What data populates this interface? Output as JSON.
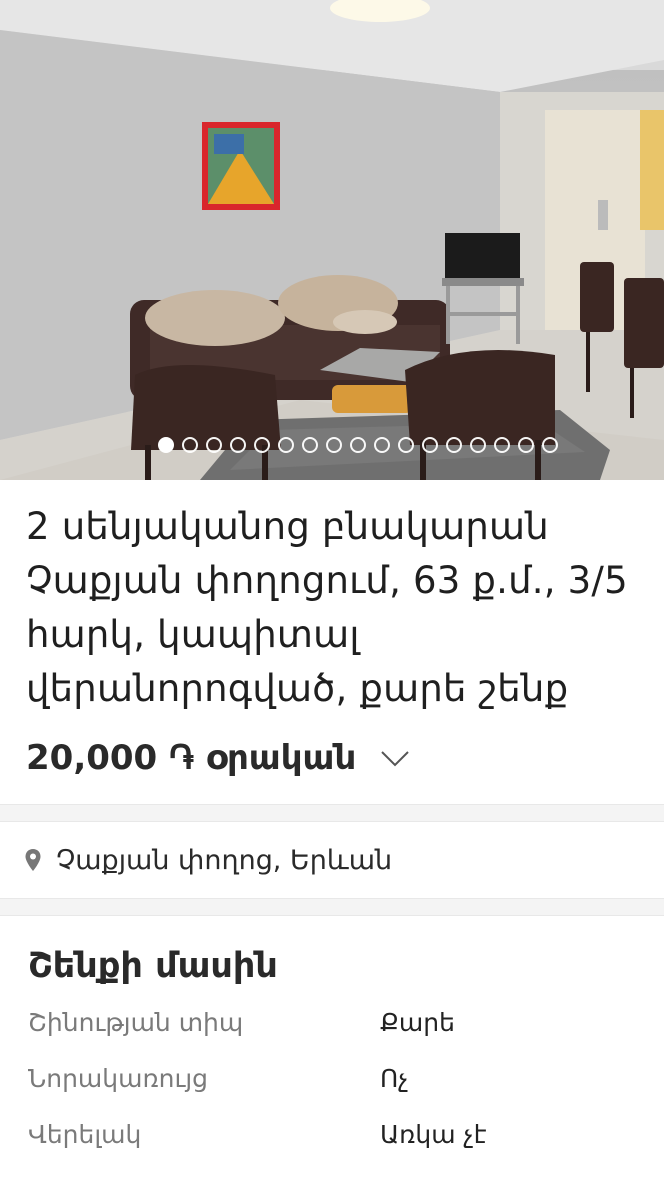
{
  "gallery": {
    "photo_description": "living-room",
    "slide_count": 17,
    "active_slide": 1
  },
  "listing": {
    "title": "2 սենյականոց բնակարան Չաքյան փողոցում, 63 ք.մ., 3/5 հարկ, կապիտալ վերանորոգված, քարե շենք",
    "price": "20,000 ֏ օրական",
    "location": "Չաքյան փողոց, Երևան"
  },
  "building": {
    "heading": "Շենքի մասին",
    "specs": [
      {
        "label": "Շինության տիպ",
        "value": "Քարե"
      },
      {
        "label": "Նորակառույց",
        "value": "Ոչ"
      },
      {
        "label": "Վերելակ",
        "value": "Առկա չէ"
      }
    ]
  },
  "colors": {
    "divider": "#f4f4f4",
    "label_gray": "#7a7a7a",
    "text_dark": "#222222"
  },
  "icons": {
    "location": "map-pin-icon",
    "price_expand": "chevron-down-icon"
  }
}
